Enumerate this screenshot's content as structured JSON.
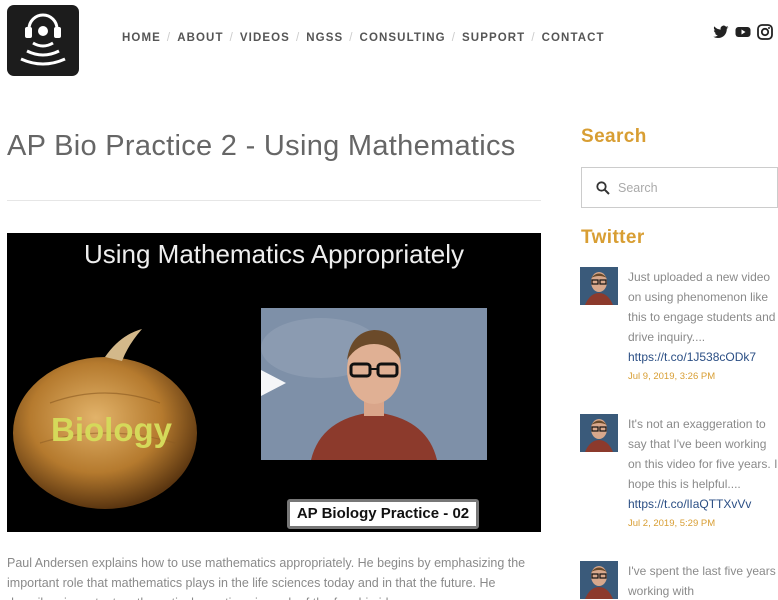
{
  "header": {
    "nav": [
      "HOME",
      "ABOUT",
      "VIDEOS",
      "NGSS",
      "CONSULTING",
      "SUPPORT",
      "CONTACT"
    ],
    "social": [
      "twitter-icon",
      "youtube-icon",
      "instagram-icon"
    ]
  },
  "post": {
    "title": "AP Bio Practice 2 - Using Mathematics",
    "video": {
      "heading": "Using Mathematics Appropriately",
      "onion_label": "Biology",
      "caption": "AP Biology Practice - 02"
    },
    "description": "Paul Andersen explains how to use mathematics appropriately. He begins by emphasizing the important role that mathematics plays in the life sciences today and in that the future. He describes important mathematical equations in each of the four big ideas."
  },
  "sidebar": {
    "search_heading": "Search",
    "search_placeholder": "Search",
    "twitter_heading": "Twitter",
    "tweets": [
      {
        "text": "Just uploaded a new video on using phenomenon like this to engage students and drive inquiry....",
        "link": "https://t.co/1J538cODk7",
        "date": "Jul 9, 2019, 3:26 PM"
      },
      {
        "text": "It's not an exaggeration to say that I've been working on this video for five years. I hope this is helpful....",
        "link": "https://t.co/lIaQTTXvVv",
        "date": "Jul 2, 2019, 5:29 PM"
      },
      {
        "text": "I've spent the last five years working with",
        "link": "",
        "date": ""
      }
    ]
  },
  "colors": {
    "accent": "#d89e33",
    "link": "#2a4e84",
    "logo_bg": "#1c1c1c"
  }
}
